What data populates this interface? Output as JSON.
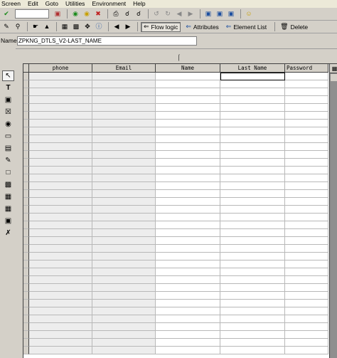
{
  "menu": [
    "Screen",
    "Edit",
    "Goto",
    "Utilities",
    "Environment",
    "Help"
  ],
  "toolbar1": {
    "icons": [
      "check-icon",
      "save-icon",
      "back-icon",
      "exit-icon",
      "cancel-icon",
      "print-icon",
      "find-icon",
      "find-next-icon",
      "first-page-icon",
      "prev-page-icon",
      "next-page-icon",
      "last-page-icon",
      "create-session-icon",
      "shortcut-icon",
      "help-icon"
    ]
  },
  "toolbar2": {
    "flow_logic": "Flow logic",
    "attributes": "Attributes",
    "element_list": "Element List",
    "delete": "Delete"
  },
  "name_row": {
    "label": "Name",
    "value": "ZPKNG_DTLS_V2-LAST_NAME"
  },
  "table": {
    "columns": [
      "phone",
      "Email",
      "Name",
      "Last Name",
      "Password"
    ],
    "row_count": 36
  },
  "colors": {
    "window_bg": "#d4d0c8",
    "menu_bg": "#ece9d8",
    "grid_line": "#b8b8b8",
    "input_cell_bg": "#ededed"
  }
}
